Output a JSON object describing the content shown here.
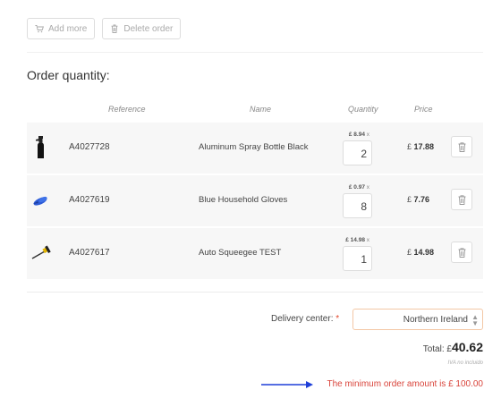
{
  "toolbar": {
    "add_more": "Add more",
    "delete_order": "Delete order"
  },
  "section_title": "Order quantity:",
  "table": {
    "headers": {
      "reference": "Reference",
      "name": "Name",
      "quantity": "Quantity",
      "price": "Price"
    },
    "rows": [
      {
        "reference": "A4027728",
        "name": "Aluminum Spray Bottle Black",
        "unit_price": "£ 8.94",
        "unit_suffix": "x",
        "quantity": "2",
        "price_currency": "£",
        "price": "17.88",
        "image_icon": "spray-bottle-icon"
      },
      {
        "reference": "A4027619",
        "name": "Blue Household Gloves",
        "unit_price": "£ 0.97",
        "unit_suffix": "x",
        "quantity": "8",
        "price_currency": "£",
        "price": "7.76",
        "image_icon": "gloves-icon"
      },
      {
        "reference": "A4027617",
        "name": "Auto Squeegee TEST",
        "unit_price": "£ 14.98",
        "unit_suffix": "x",
        "quantity": "1",
        "price_currency": "£",
        "price": "14.98",
        "image_icon": "squeegee-icon"
      }
    ]
  },
  "delivery": {
    "label": "Delivery center:",
    "required_mark": "*",
    "selected": "Northern Ireland"
  },
  "total": {
    "label": "Total: £",
    "value": "40.62",
    "tax_note": "IVA no incluido"
  },
  "minimum_message": "The minimum order amount is £ 100.00",
  "colors": {
    "row_background": "#f7f7f7",
    "error": "#d9443b",
    "arrow": "#1e3fd9",
    "select_border": "#f3c7a5"
  }
}
